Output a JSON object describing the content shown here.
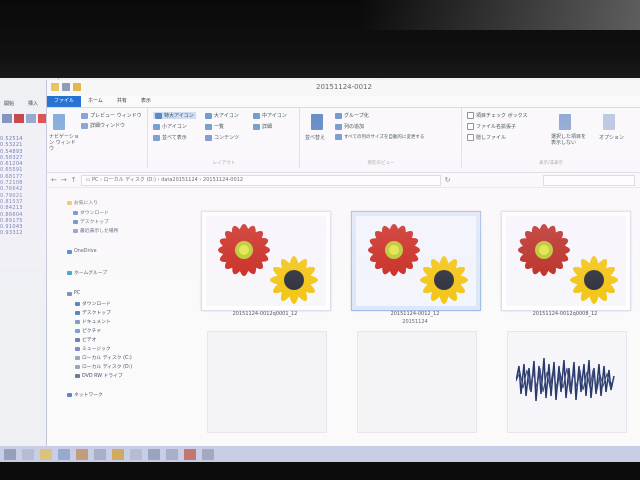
{
  "window_title": "20151124-0012",
  "tabs": [
    {
      "label": "ファイル"
    },
    {
      "label": "ホーム"
    },
    {
      "label": "共有"
    },
    {
      "label": "表示"
    }
  ],
  "ribbon": {
    "preview_pane": "プレビュー ウィンドウ",
    "details_pane": "詳細ウィンドウ",
    "nav_pane": "ナビゲーション ウィンドウ",
    "layout": [
      "特大アイコン",
      "大アイコン",
      "中アイコン",
      "小アイコン",
      "一覧",
      "詳細",
      "並べて表示",
      "コンテンツ"
    ],
    "layout_group": "レイアウト",
    "sort_by": "並べ替え",
    "group_by": "グループ化",
    "add_columns": "列の追加",
    "fit_columns": "すべての列のサイズを自動的に変更する",
    "current_view_group": "現在のビュー",
    "item_checkboxes": "項目チェック ボックス",
    "file_extensions": "ファイル名拡張子",
    "hidden_items": "隠しファイル",
    "hide_selected": "選択した項目を表示しない",
    "options": "オプション",
    "showhide_group": "表示/非表示"
  },
  "address": {
    "breadcrumb": [
      "PC",
      "ローカル ディスク (D:)",
      "data20151124",
      "20151124-0012"
    ]
  },
  "nav": {
    "favorites": "お気に入り",
    "downloads": "ダウンロード",
    "desktop": "デスクトップ",
    "recent": "最近表示した場所",
    "onedrive": "OneDrive",
    "homegroup": "ホームグループ",
    "pc": "PC",
    "pc_items": [
      "ダウンロード",
      "デスクトップ",
      "ドキュメント",
      "ピクチャ",
      "ビデオ",
      "ミュージック",
      "ローカル ディスク (C:)",
      "ローカル ディスク (D:)",
      "DVD RW ドライブ"
    ],
    "network": "ネットワーク"
  },
  "files": [
    {
      "name": "20151124-0012q0001_12"
    },
    {
      "name": "20151124-0012_12"
    },
    {
      "name": "20151124-0012q0008_12"
    }
  ],
  "under_label": "20151124",
  "bg_window": {
    "tabs": [
      "開始",
      "挿入"
    ],
    "rows": [
      "0.52514",
      "0.53221",
      "0.54893",
      "0.58327",
      "0.61204",
      "0.65591",
      "0.68177",
      "0.72108",
      "0.76642",
      "0.79021",
      "0.81537",
      "0.84213",
      "0.86604",
      "0.89175",
      "0.91043",
      "0.93312"
    ]
  },
  "colors": {
    "file_tab": "#1c6cd1",
    "selected": "#dbe8f7",
    "petal_red": "#c8261b",
    "petal_yellow": "#f3c514"
  },
  "icons": [
    "back-icon",
    "forward-icon",
    "up-icon",
    "refresh-icon",
    "search-icon",
    "star-icon",
    "cloud-icon",
    "homegroup-icon",
    "pc-icon",
    "network-icon"
  ]
}
